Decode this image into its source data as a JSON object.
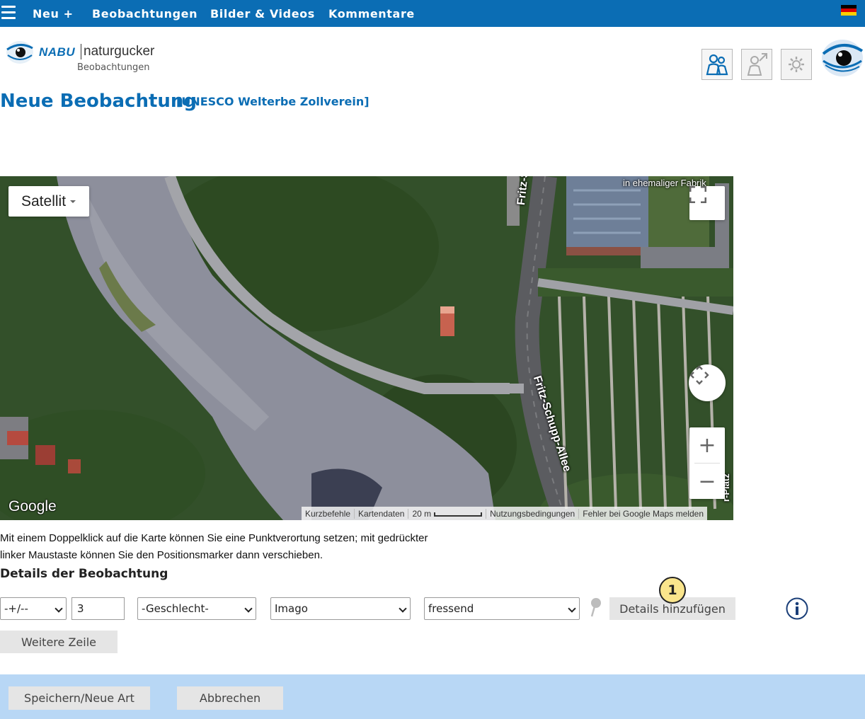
{
  "nav": {
    "items": [
      {
        "label": "Neu +"
      },
      {
        "label": "Beobachtungen"
      },
      {
        "label": "Bilder & Videos"
      },
      {
        "label": "Kommentare"
      }
    ],
    "flag_colors": [
      "#000000",
      "#dd0000",
      "#ffce00"
    ]
  },
  "header": {
    "logo_brand": "NABU",
    "logo_name": "naturgucker",
    "logo_sub": "Beobachtungen",
    "icons": [
      "people-icon",
      "share-person-icon",
      "gear-icon"
    ]
  },
  "page": {
    "title": "Neue Beobachtung",
    "subtitle": "[UNESCO Welterbe Zollverein]"
  },
  "map": {
    "type_label": "Satellit",
    "google_label": "Google",
    "place_label": "in ehemaliger Fabrik",
    "street_1": "Fritz-Schup",
    "street_2": "Fritz-Schupp-Allee",
    "street_3": "r-Platz",
    "attribution": {
      "shortcuts": "Kurzbefehle",
      "mapdata": "Kartendaten",
      "scale": "20 m",
      "terms": "Nutzungsbedingungen",
      "report": "Fehler bei Google Maps melden"
    }
  },
  "hint": {
    "line1": "Mit einem Doppelklick auf die Karte können Sie eine Punktverortung setzen; mit gedrückter",
    "line2": "linker Maustaste können Sie den Positionsmarker dann verschieben."
  },
  "details": {
    "title": "Details der Beobachtung",
    "accuracy": "-+/--",
    "count": "3",
    "sex": "-Geschlecht-",
    "stage": "Imago",
    "behavior": "fressend",
    "add_details": "Details hinzufügen",
    "more_row": "Weitere Zeile",
    "badge": "1"
  },
  "actions": {
    "save": "Speichern/Neue Art",
    "cancel": "Abbrechen"
  },
  "colors": {
    "brand_blue": "#0b6db4",
    "bottom_bar": "#b8d7f5",
    "badge": "#fae58c"
  }
}
